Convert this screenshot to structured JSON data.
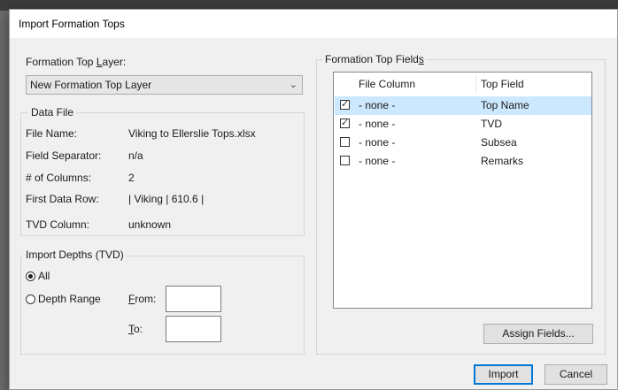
{
  "window": {
    "title": "Import Formation Tops"
  },
  "layer": {
    "label_pre": "Formation Top ",
    "label_accel": "L",
    "label_post": "ayer:",
    "selected": "New Formation Top Layer"
  },
  "data_file": {
    "legend": "Data File",
    "rows": [
      {
        "label": "File Name:",
        "value": "Viking to Ellerslie Tops.xlsx"
      },
      {
        "label": "Field Separator:",
        "value": "n/a"
      },
      {
        "label": "# of Columns:",
        "value": "2"
      },
      {
        "label": "First Data Row:",
        "value": "| Viking | 610.6 |"
      },
      {
        "label": "TVD Column:",
        "value": "unknown"
      }
    ]
  },
  "import_depths": {
    "legend": "Import Depths (TVD)",
    "all_label": "All",
    "range_label": "Depth Range",
    "from_accel": "F",
    "from_rest": "rom:",
    "to_accel": "T",
    "to_rest": "o:",
    "from_value": "",
    "to_value": ""
  },
  "fields": {
    "legend_pre": "Formation Top Field",
    "legend_accel": "s",
    "columns": [
      "File Column",
      "Top Field"
    ],
    "rows": [
      {
        "checked": true,
        "file_column": "- none -",
        "top_field": "Top Name",
        "selected": true
      },
      {
        "checked": true,
        "file_column": "- none -",
        "top_field": "TVD",
        "selected": false
      },
      {
        "checked": false,
        "file_column": "- none -",
        "top_field": "Subsea",
        "selected": false
      },
      {
        "checked": false,
        "file_column": "- none -",
        "top_field": "Remarks",
        "selected": false
      }
    ],
    "assign_button": "Assign Fields..."
  },
  "footer": {
    "import_button": "Import",
    "cancel_button": "Cancel"
  }
}
